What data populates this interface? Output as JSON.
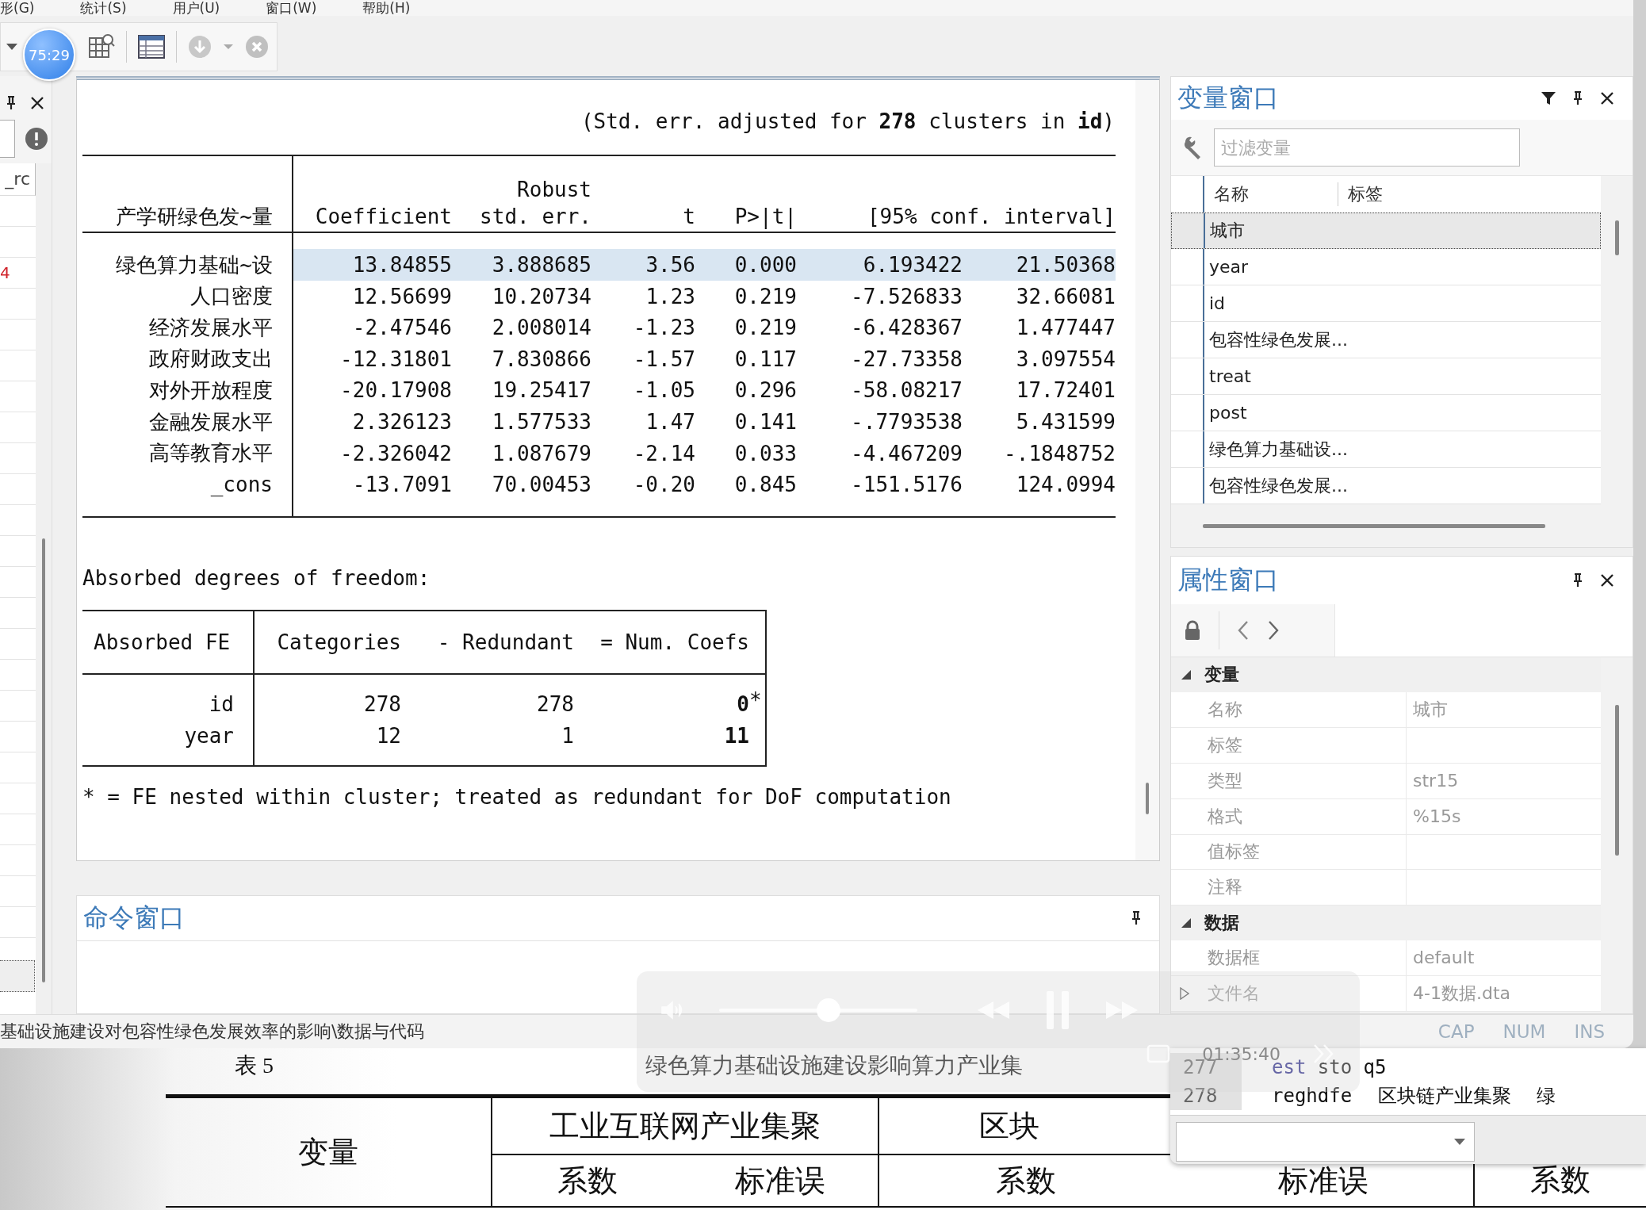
{
  "menu": [
    "形(G)",
    "统计(S)",
    "用户(U)",
    "窗口(W)",
    "帮助(H)"
  ],
  "timer_badge": "75:29",
  "left_panel": {
    "column_header": "_rc",
    "cells": [
      "4"
    ]
  },
  "results": {
    "note": "(Std. err. adjusted for **278** clusters in **id**)",
    "columns": [
      {
        "label": "产学研绿色发~量"
      },
      {
        "label": "Coefficient"
      },
      {
        "over": "Robust",
        "label": "std. err."
      },
      {
        "label": "t"
      },
      {
        "label": "P>|t|"
      },
      {
        "label": "[95% conf. interval]"
      }
    ],
    "rows": [
      {
        "name": "绿色算力基础~设",
        "values": [
          "13.84855",
          "3.888685",
          "3.56",
          "0.000",
          "6.193422",
          "21.50368"
        ],
        "selected": true
      },
      {
        "name": "人口密度",
        "values": [
          "12.56699",
          "10.20734",
          "1.23",
          "0.219",
          "-7.526833",
          "32.66081"
        ],
        "selected": false
      },
      {
        "name": "经济发展水平",
        "values": [
          "-2.47546",
          "2.008014",
          "-1.23",
          "0.219",
          "-6.428367",
          "1.477447"
        ],
        "selected": false
      },
      {
        "name": "政府财政支出",
        "values": [
          "-12.31801",
          "7.830866",
          "-1.57",
          "0.117",
          "-27.73358",
          "3.097554"
        ],
        "selected": false
      },
      {
        "name": "对外开放程度",
        "values": [
          "-20.17908",
          "19.25417",
          "-1.05",
          "0.296",
          "-58.08217",
          "17.72401"
        ],
        "selected": false
      },
      {
        "name": "金融发展水平",
        "values": [
          "2.326123",
          "1.577533",
          "1.47",
          "0.141",
          "-.7793538",
          "5.431599"
        ],
        "selected": false
      },
      {
        "name": "高等教育水平",
        "values": [
          "-2.326042",
          "1.087679",
          "-2.14",
          "0.033",
          "-4.467209",
          "-.1848752"
        ],
        "selected": false
      },
      {
        "name": "_cons",
        "values": [
          "-13.7091",
          "70.00453",
          "-0.20",
          "0.845",
          "-151.5176",
          "124.0994"
        ],
        "selected": false
      }
    ],
    "absorbed_title": "Absorbed degrees of freedom:",
    "absorbed_columns": [
      "Absorbed FE",
      "Categories",
      "- Redundant",
      "= Num. Coefs"
    ],
    "absorbed_rows": [
      {
        "name": "id",
        "values": [
          "278",
          "278",
          "0"
        ],
        "flag": "*"
      },
      {
        "name": "year",
        "values": [
          "12",
          "1",
          "11"
        ]
      }
    ],
    "footnote": "* = FE nested within cluster; treated as redundant for DoF computation"
  },
  "command_window": {
    "title": "命令窗口"
  },
  "variables_window": {
    "title": "变量窗口",
    "filter_placeholder": "过滤变量",
    "columns": [
      "名称",
      "标签"
    ],
    "rows": [
      {
        "name": "城市",
        "selected": true
      },
      {
        "name": "year",
        "selected": false
      },
      {
        "name": "id",
        "selected": false
      },
      {
        "name": "包容性绿色发展...",
        "selected": false
      },
      {
        "name": "treat",
        "selected": false
      },
      {
        "name": "post",
        "selected": false
      },
      {
        "name": "绿色算力基础设...",
        "selected": false
      },
      {
        "name": "包容性绿色发展...",
        "selected": false
      }
    ]
  },
  "properties_window": {
    "title": "属性窗口",
    "groups": [
      {
        "title": "变量",
        "expanded": true,
        "rows": [
          {
            "label": "名称",
            "value": "城市",
            "expandable": false
          },
          {
            "label": "标签",
            "expandable": false
          },
          {
            "label": "类型",
            "value": "str15",
            "expandable": false
          },
          {
            "label": "格式",
            "value": "%15s",
            "expandable": false
          },
          {
            "label": "值标签",
            "expandable": false
          },
          {
            "label": "注释",
            "expandable": false
          }
        ]
      },
      {
        "title": "数据",
        "expanded": true,
        "rows": [
          {
            "label": "数据框",
            "value": "default",
            "expandable": false
          },
          {
            "label": "文件名",
            "value": "4-1数据.dta",
            "expandable": true
          }
        ]
      }
    ]
  },
  "status_bar": {
    "path": "基础设施建设对包容性绿色发展效率的影响\\数据与代码",
    "indicators": [
      "CAP",
      "NUM",
      "INS"
    ]
  },
  "video_overlay": {
    "time": "01:35:40",
    "level": 0.55
  },
  "do_file": {
    "lines": [
      {
        "number": "277",
        "tokens": [
          {
            "text": "est",
            "kind": "keyword"
          },
          {
            "text": "sto q5",
            "kind": "plain"
          }
        ]
      },
      {
        "number": "278",
        "tokens": [
          {
            "text": "reghdfe",
            "kind": "plain"
          },
          {
            "text": "区块链产业集聚",
            "kind": "plain"
          },
          {
            "text": "绿",
            "kind": "plain"
          }
        ]
      }
    ]
  },
  "document": {
    "caption": "表 5",
    "title": "绿色算力基础设施建设影响算力产业集",
    "row_label": "变量",
    "groups": [
      "工业互联网产业集聚",
      "区块"
    ],
    "subcolumns": [
      "系数",
      "标准误",
      "系数",
      "标准误",
      "系数"
    ]
  }
}
